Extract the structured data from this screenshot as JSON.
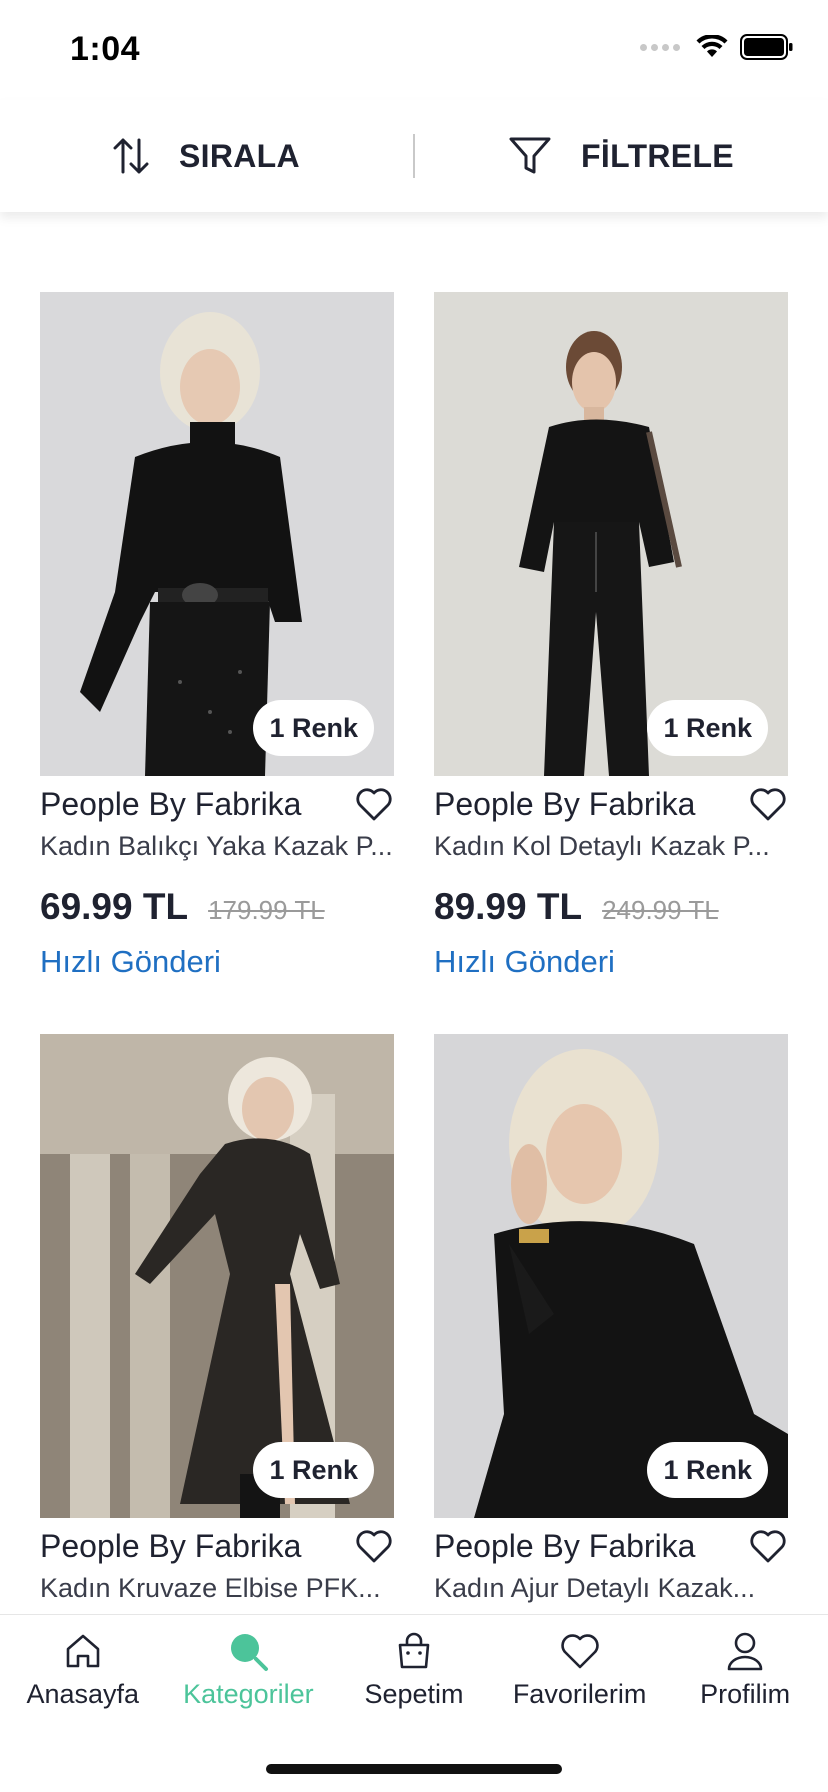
{
  "status": {
    "time": "1:04"
  },
  "actions": {
    "sort_label": "SIRALA",
    "filter_label": "FİLTRELE"
  },
  "products": [
    {
      "color_badge": "1 Renk",
      "brand": "People By Fabrika",
      "description": "Kadın Balıkçı Yaka  Kazak P...",
      "price": "69.99 TL",
      "old_price": "179.99 TL",
      "shipping": "Hızlı Gönderi"
    },
    {
      "color_badge": "1 Renk",
      "brand": "People By Fabrika",
      "description": "Kadın Kol Detaylı  Kazak P...",
      "price": "89.99 TL",
      "old_price": "249.99 TL",
      "shipping": "Hızlı Gönderi"
    },
    {
      "color_badge": "1 Renk",
      "brand": "People By Fabrika",
      "description": "Kadın Kruvaze  Elbise PFK..."
    },
    {
      "color_badge": "1 Renk",
      "brand": "People By Fabrika",
      "description": "Kadın Ajur Detaylı  Kazak..."
    }
  ],
  "tabs": [
    {
      "label": "Anasayfa",
      "icon": "home-icon"
    },
    {
      "label": "Kategoriler",
      "icon": "search-icon"
    },
    {
      "label": "Sepetim",
      "icon": "basket-icon"
    },
    {
      "label": "Favorilerim",
      "icon": "heart-icon"
    },
    {
      "label": "Profilim",
      "icon": "user-icon"
    }
  ],
  "colors": {
    "accent": "#4cc49a",
    "link": "#1f6fc2",
    "text": "#1f2230"
  }
}
